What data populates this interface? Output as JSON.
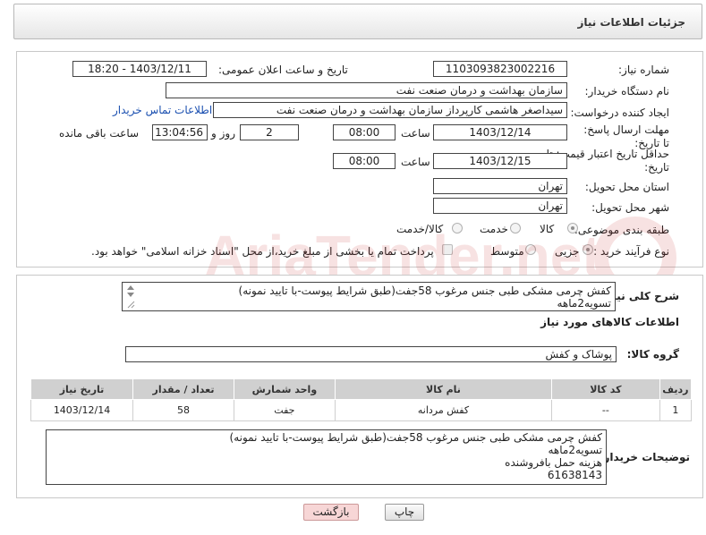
{
  "header": {
    "title": "جزئیات اطلاعات نیاز"
  },
  "fields": {
    "need_number_label": "شماره نیاز:",
    "need_number": "1103093823002216",
    "announce_label": "تاریخ و ساعت اعلان عمومی:",
    "announce_value": "1403/12/11 - 18:20",
    "buyer_org_label": "نام دستگاه خریدار:",
    "buyer_org": "سازمان بهداشت و درمان صنعت نفت",
    "creator_label": "ایجاد کننده درخواست:",
    "creator": "سیداصغر هاشمی کارپرداز سازمان بهداشت و درمان صنعت نفت",
    "contact_link": "اطلاعات تماس خریدار",
    "deadline_label": "مهلت ارسال پاسخ: تا تاریخ:",
    "deadline_date": "1403/12/14",
    "time_label": "ساعت",
    "deadline_time": "08:00",
    "days_value": "2",
    "days_label": "روز و",
    "remaining_time": "13:04:56",
    "remaining_label": "ساعت باقی مانده",
    "min_valid_label": "حداقل تاریخ اعتبار قیمت: تا تاریخ:",
    "min_valid_date": "1403/12/15",
    "min_valid_time": "08:00",
    "province_label": "استان محل تحویل:",
    "province": "تهران",
    "city_label": "شهر محل تحویل:",
    "city": "تهران",
    "category_label": "طبقه بندی موضوعی:",
    "category_options": [
      "کالا",
      "خدمت",
      "کالا/خدمت"
    ],
    "process_label": "نوع فرآیند خرید :",
    "process_options": [
      "جزیی",
      "متوسط"
    ],
    "payment_note": "پرداخت تمام یا بخشی از مبلغ خرید،از محل \"اسناد خزانه اسلامی\" خواهد بود."
  },
  "summary": {
    "label": "شرح کلی نیاز:",
    "lines": [
      "کفش چرمی مشکی طبی جنس مرغوب 58جفت(طبق شرایط پیوست-با تایید نمونه)",
      "تسویه2ماهه"
    ]
  },
  "goods_section": {
    "title": "اطلاعات کالاهای مورد نیاز",
    "group_label": "گروه کالا:",
    "group_value": "پوشاک و کفش"
  },
  "table": {
    "headers": [
      "ردیف",
      "کد کالا",
      "نام کالا",
      "واحد شمارش",
      "تعداد / مقدار",
      "تاریخ نیاز"
    ],
    "rows": [
      [
        "1",
        "--",
        "کفش مردانه",
        "جفت",
        "58",
        "1403/12/14"
      ]
    ]
  },
  "buyer_notes": {
    "label": "توضیحات خریدار:",
    "lines": [
      "کفش چرمی مشکی طبی جنس مرغوب 58جفت(طبق شرایط پیوست-با تایید نمونه)",
      "تسویه2ماهه",
      "هزینه حمل بافروشنده",
      "61638143"
    ]
  },
  "buttons": {
    "print": "چاپ",
    "back": "بازگشت"
  },
  "colors": {
    "link": "#1a4fb0",
    "header_bg": "#e6e6e6",
    "table_header": "#d0d0d0",
    "back_button": "#f7d6d6"
  }
}
